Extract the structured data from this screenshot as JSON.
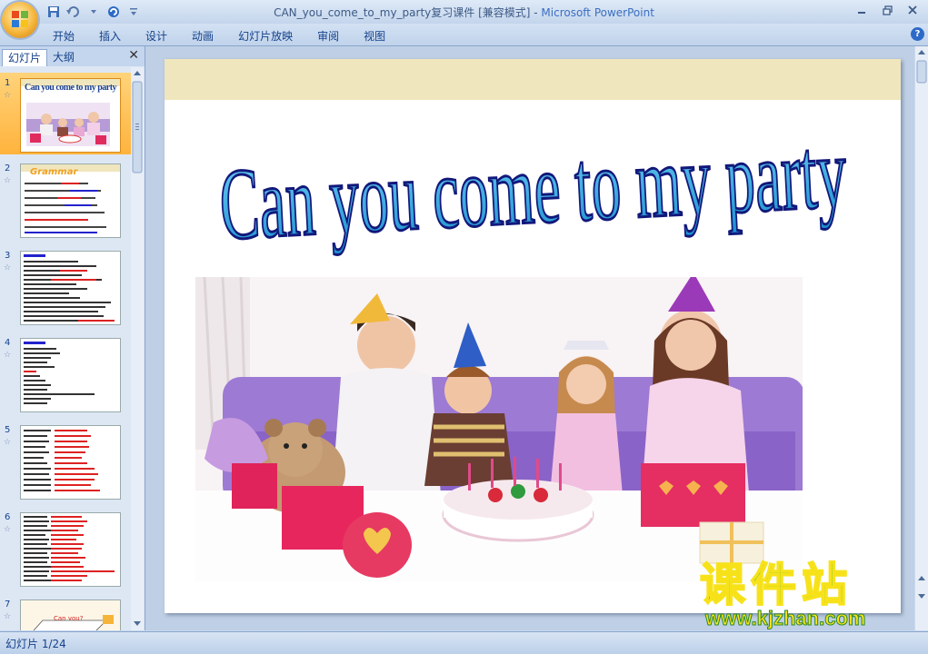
{
  "window": {
    "title_doc": "CAN_you_come_to_my_party复习课件 [兼容模式]",
    "title_sep": " - ",
    "title_app": "Microsoft PowerPoint"
  },
  "ribbon": {
    "tabs": [
      "开始",
      "插入",
      "设计",
      "动画",
      "幻灯片放映",
      "审阅",
      "视图"
    ]
  },
  "left_pane": {
    "tab_slides": "幻灯片",
    "tab_outline": "大纲",
    "close": "✕",
    "thumbnails": [
      {
        "number": "1",
        "title": "Can you come to my party"
      },
      {
        "number": "2",
        "title": "Grammar"
      },
      {
        "number": "3",
        "title": ""
      },
      {
        "number": "4",
        "title": ""
      },
      {
        "number": "5",
        "title": ""
      },
      {
        "number": "6",
        "title": ""
      },
      {
        "number": "7",
        "title": "Can you?"
      }
    ]
  },
  "slide": {
    "title": "Can you come to my party"
  },
  "status": {
    "slide_indicator": "幻灯片 1/24"
  },
  "watermark": {
    "cn": "课件站",
    "url": "www.kjzhan.com"
  },
  "colors": {
    "accent": "#15428b",
    "title_fill": "#22a6dd",
    "title_stroke": "#12187a",
    "selected_thumb": "#ffb33d",
    "watermark_green": "#2db12d",
    "watermark_yellow": "#f7e21a"
  }
}
